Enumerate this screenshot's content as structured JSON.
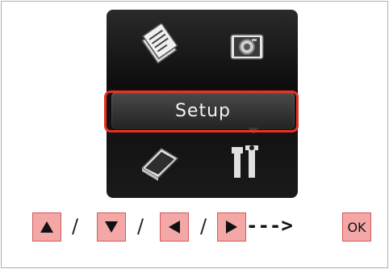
{
  "screen": {
    "menu": {
      "selected_label": "Setup",
      "items": [
        {
          "name": "copy",
          "icon": "copy-icon"
        },
        {
          "name": "photo",
          "icon": "camera-icon"
        },
        {
          "name": "scan",
          "icon": "scanner-icon"
        },
        {
          "name": "setup",
          "icon": "tools-icon"
        }
      ]
    },
    "highlight_color": "#e8321e"
  },
  "instructions": {
    "keys": [
      {
        "icon": "up-triangle-icon",
        "glyph": "▲"
      },
      {
        "icon": "down-triangle-icon",
        "glyph": "▼"
      },
      {
        "icon": "left-triangle-icon",
        "glyph": "◀"
      },
      {
        "icon": "right-triangle-icon",
        "glyph": "▶"
      }
    ],
    "separator": "/",
    "arrow": "--->",
    "ok_label": "OK",
    "key_color": "#f4a7a7"
  }
}
